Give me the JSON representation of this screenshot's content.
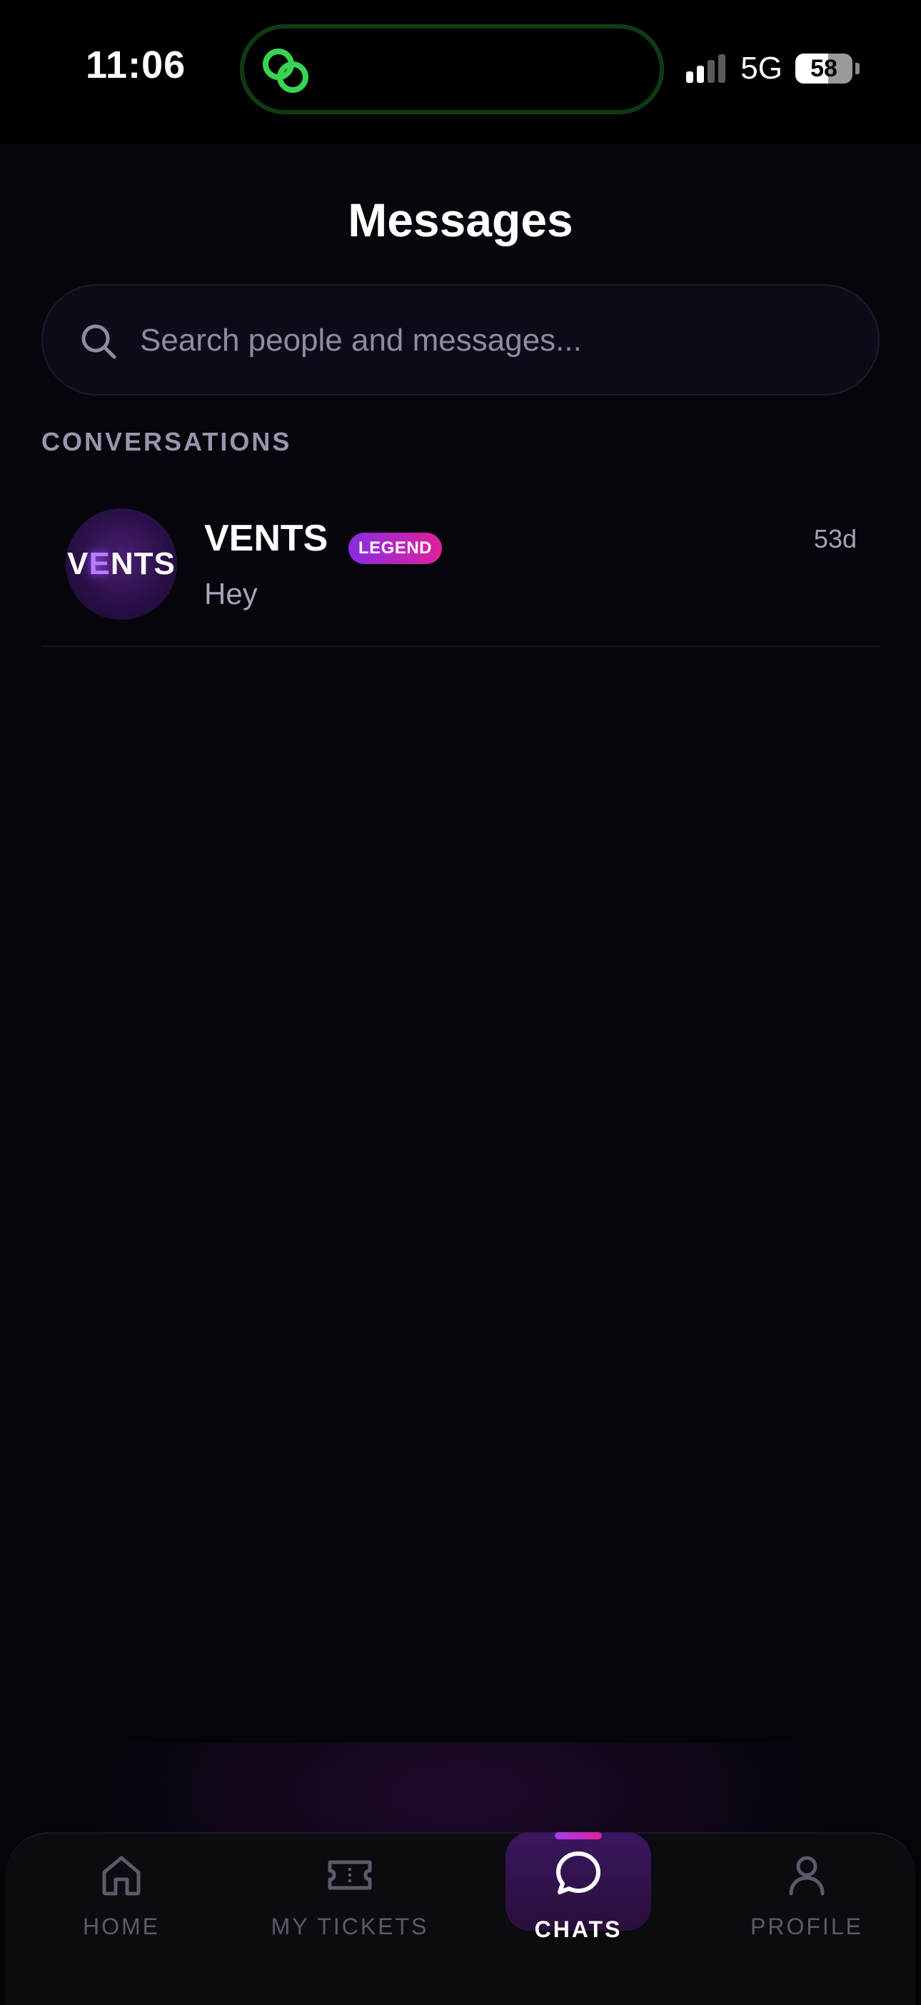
{
  "status_bar": {
    "time": "11:06",
    "network": "5G",
    "battery": "58"
  },
  "page": {
    "title": "Messages"
  },
  "search": {
    "placeholder": "Search people and messages..."
  },
  "section": {
    "label": "CONVERSATIONS"
  },
  "conversations": [
    {
      "name": "VENTS",
      "badge": "LEGEND",
      "time": "53d",
      "last_message": "Hey",
      "avatar_text_prefix": "V",
      "avatar_text_e": "E",
      "avatar_text_suffix": "NTS"
    }
  ],
  "nav": {
    "items": [
      {
        "label": "HOME",
        "icon": "home-icon"
      },
      {
        "label": "MY TICKETS",
        "icon": "ticket-icon"
      },
      {
        "label": "CHATS",
        "icon": "chat-bubble-icon",
        "active": true
      },
      {
        "label": "PROFILE",
        "icon": "profile-icon"
      }
    ]
  },
  "colors": {
    "background": "#050409",
    "accent_start": "#8a2be2",
    "accent_end": "#e0219a",
    "muted_text": "#9896ae"
  }
}
